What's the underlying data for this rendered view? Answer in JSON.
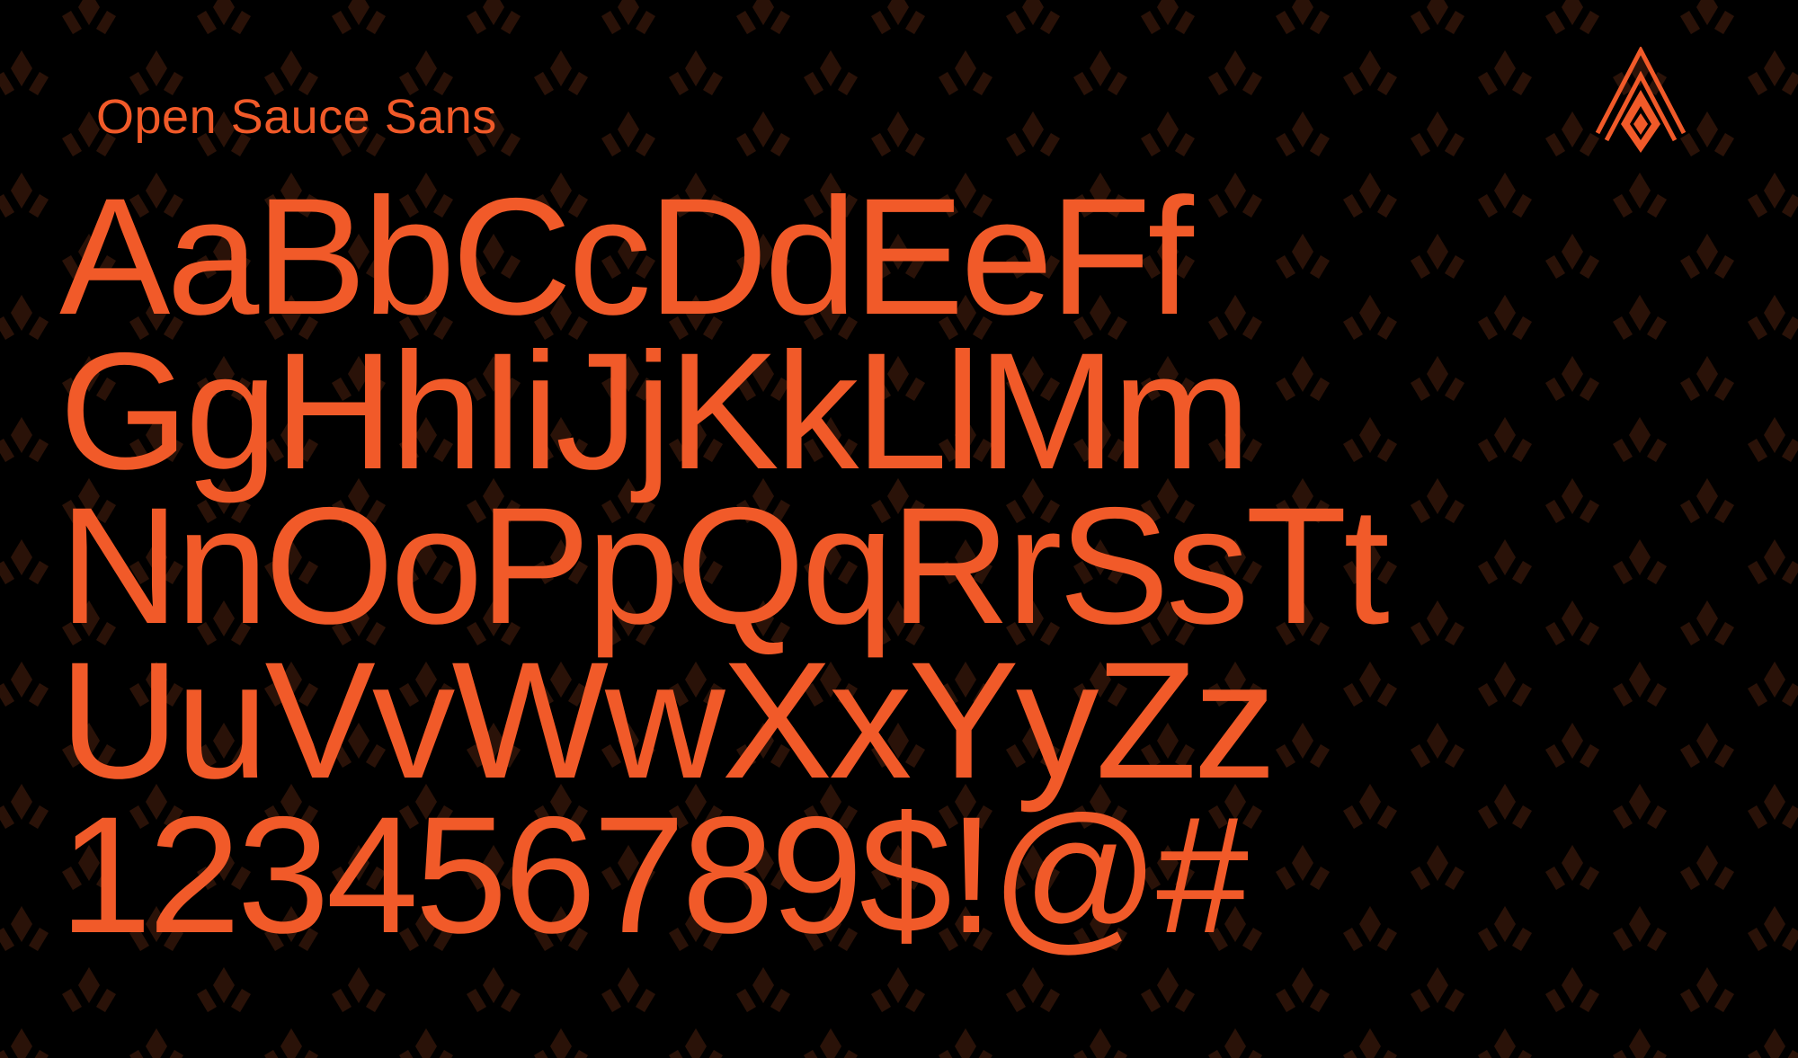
{
  "colors": {
    "background": "#000000",
    "accent": "#f15a29",
    "pattern": "#2a1208"
  },
  "header": {
    "font_name": "Open Sauce Sans"
  },
  "logo": {
    "icon": "chevron-diamond-logo-icon"
  },
  "specimen": {
    "lines": [
      "AaBbCcDdEeFf",
      "GgHhIiJjKkLlMm",
      "NnOoPpQqRrSsTt",
      "UuVvWwXxYyZz",
      "123456789$!@#"
    ]
  }
}
